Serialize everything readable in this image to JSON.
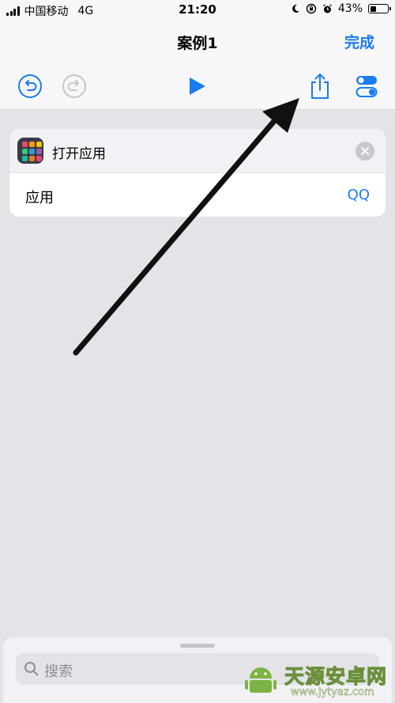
{
  "status_bar": {
    "carrier": "中国移动",
    "network": "4G",
    "time": "21:20",
    "battery_percent": "43%",
    "battery_level": 0.43,
    "icons": [
      "moon-icon",
      "rotation-lock-icon",
      "alarm-icon"
    ]
  },
  "nav": {
    "title": "案例1",
    "done_label": "完成"
  },
  "toolbar": {
    "icons": [
      "undo-icon",
      "redo-icon",
      "play-icon",
      "share-icon",
      "settings-toggle-icon"
    ]
  },
  "action": {
    "title": "打开应用",
    "param_label": "应用",
    "param_value": "QQ",
    "icon_colors": [
      "#e84a5f",
      "#f39c12",
      "#f1c40f",
      "#2ecc71",
      "#3498db",
      "#9b59b6",
      "#1abc9c",
      "#e67e22",
      "#ec407a"
    ]
  },
  "search": {
    "placeholder": "搜索"
  },
  "watermark": {
    "brand": "天源安卓网",
    "url": "www.jytyaz.com"
  },
  "colors": {
    "accent": "#1a7cf0",
    "background": "#e3e3e8",
    "bar": "#f7f7f9"
  }
}
